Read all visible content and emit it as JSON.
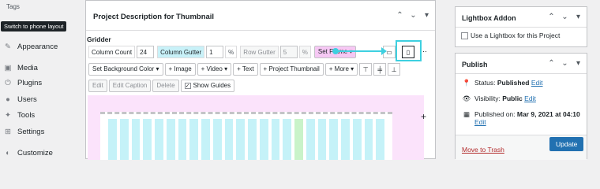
{
  "sidebar": {
    "tags": "Tags",
    "tooltip": "Switch to phone layout",
    "items": [
      {
        "label": "Appearance",
        "icon": "paintbrush-icon"
      },
      {
        "label": "Media",
        "icon": "media-icon"
      },
      {
        "label": "Plugins",
        "icon": "plugins-icon"
      },
      {
        "label": "Users",
        "icon": "users-icon"
      },
      {
        "label": "Tools",
        "icon": "tools-icon"
      },
      {
        "label": "Settings",
        "icon": "settings-icon"
      },
      {
        "label": "Customize",
        "icon": "customize-icon"
      }
    ]
  },
  "main": {
    "title": "Project Description for Thumbnail",
    "grid_title": "Gridder",
    "toolbar1": {
      "column_count_label": "Column Count",
      "column_count_value": "24",
      "column_gutter_label": "Column Gutter",
      "column_gutter_value": "1",
      "column_gutter_unit": "%",
      "row_gutter_label": "Row Gutter",
      "row_gutter_value": "5",
      "row_gutter_unit": "%",
      "set_frame": "Set Frame"
    },
    "toolbar2": {
      "set_bg": "Set Background Color",
      "image": "+ Image",
      "video": "+ Video",
      "text": "+ Text",
      "project_thumb": "+ Project Thumbnail",
      "more": "+ More"
    },
    "toolbar3": {
      "edit": "Edit",
      "edit_caption": "Edit Caption",
      "delete": "Delete",
      "show_guides": "Show Guides"
    }
  },
  "lightbox": {
    "title": "Lightbox Addon",
    "checkbox_label": "Use a Lightbox for this Project"
  },
  "publish": {
    "title": "Publish",
    "status_label": "Status: ",
    "status_value": "Published",
    "visibility_label": "Visibility: ",
    "visibility_value": "Public",
    "published_on_label": "Published on: ",
    "published_on_value": "Mar 9, 2021 at 04:10",
    "edit": "Edit",
    "move_to_trash": "Move to Trash",
    "update": "Update"
  },
  "colors": {
    "accent": "#2271b1",
    "highlight": "#3ed0e0",
    "danger": "#b32d2e"
  }
}
